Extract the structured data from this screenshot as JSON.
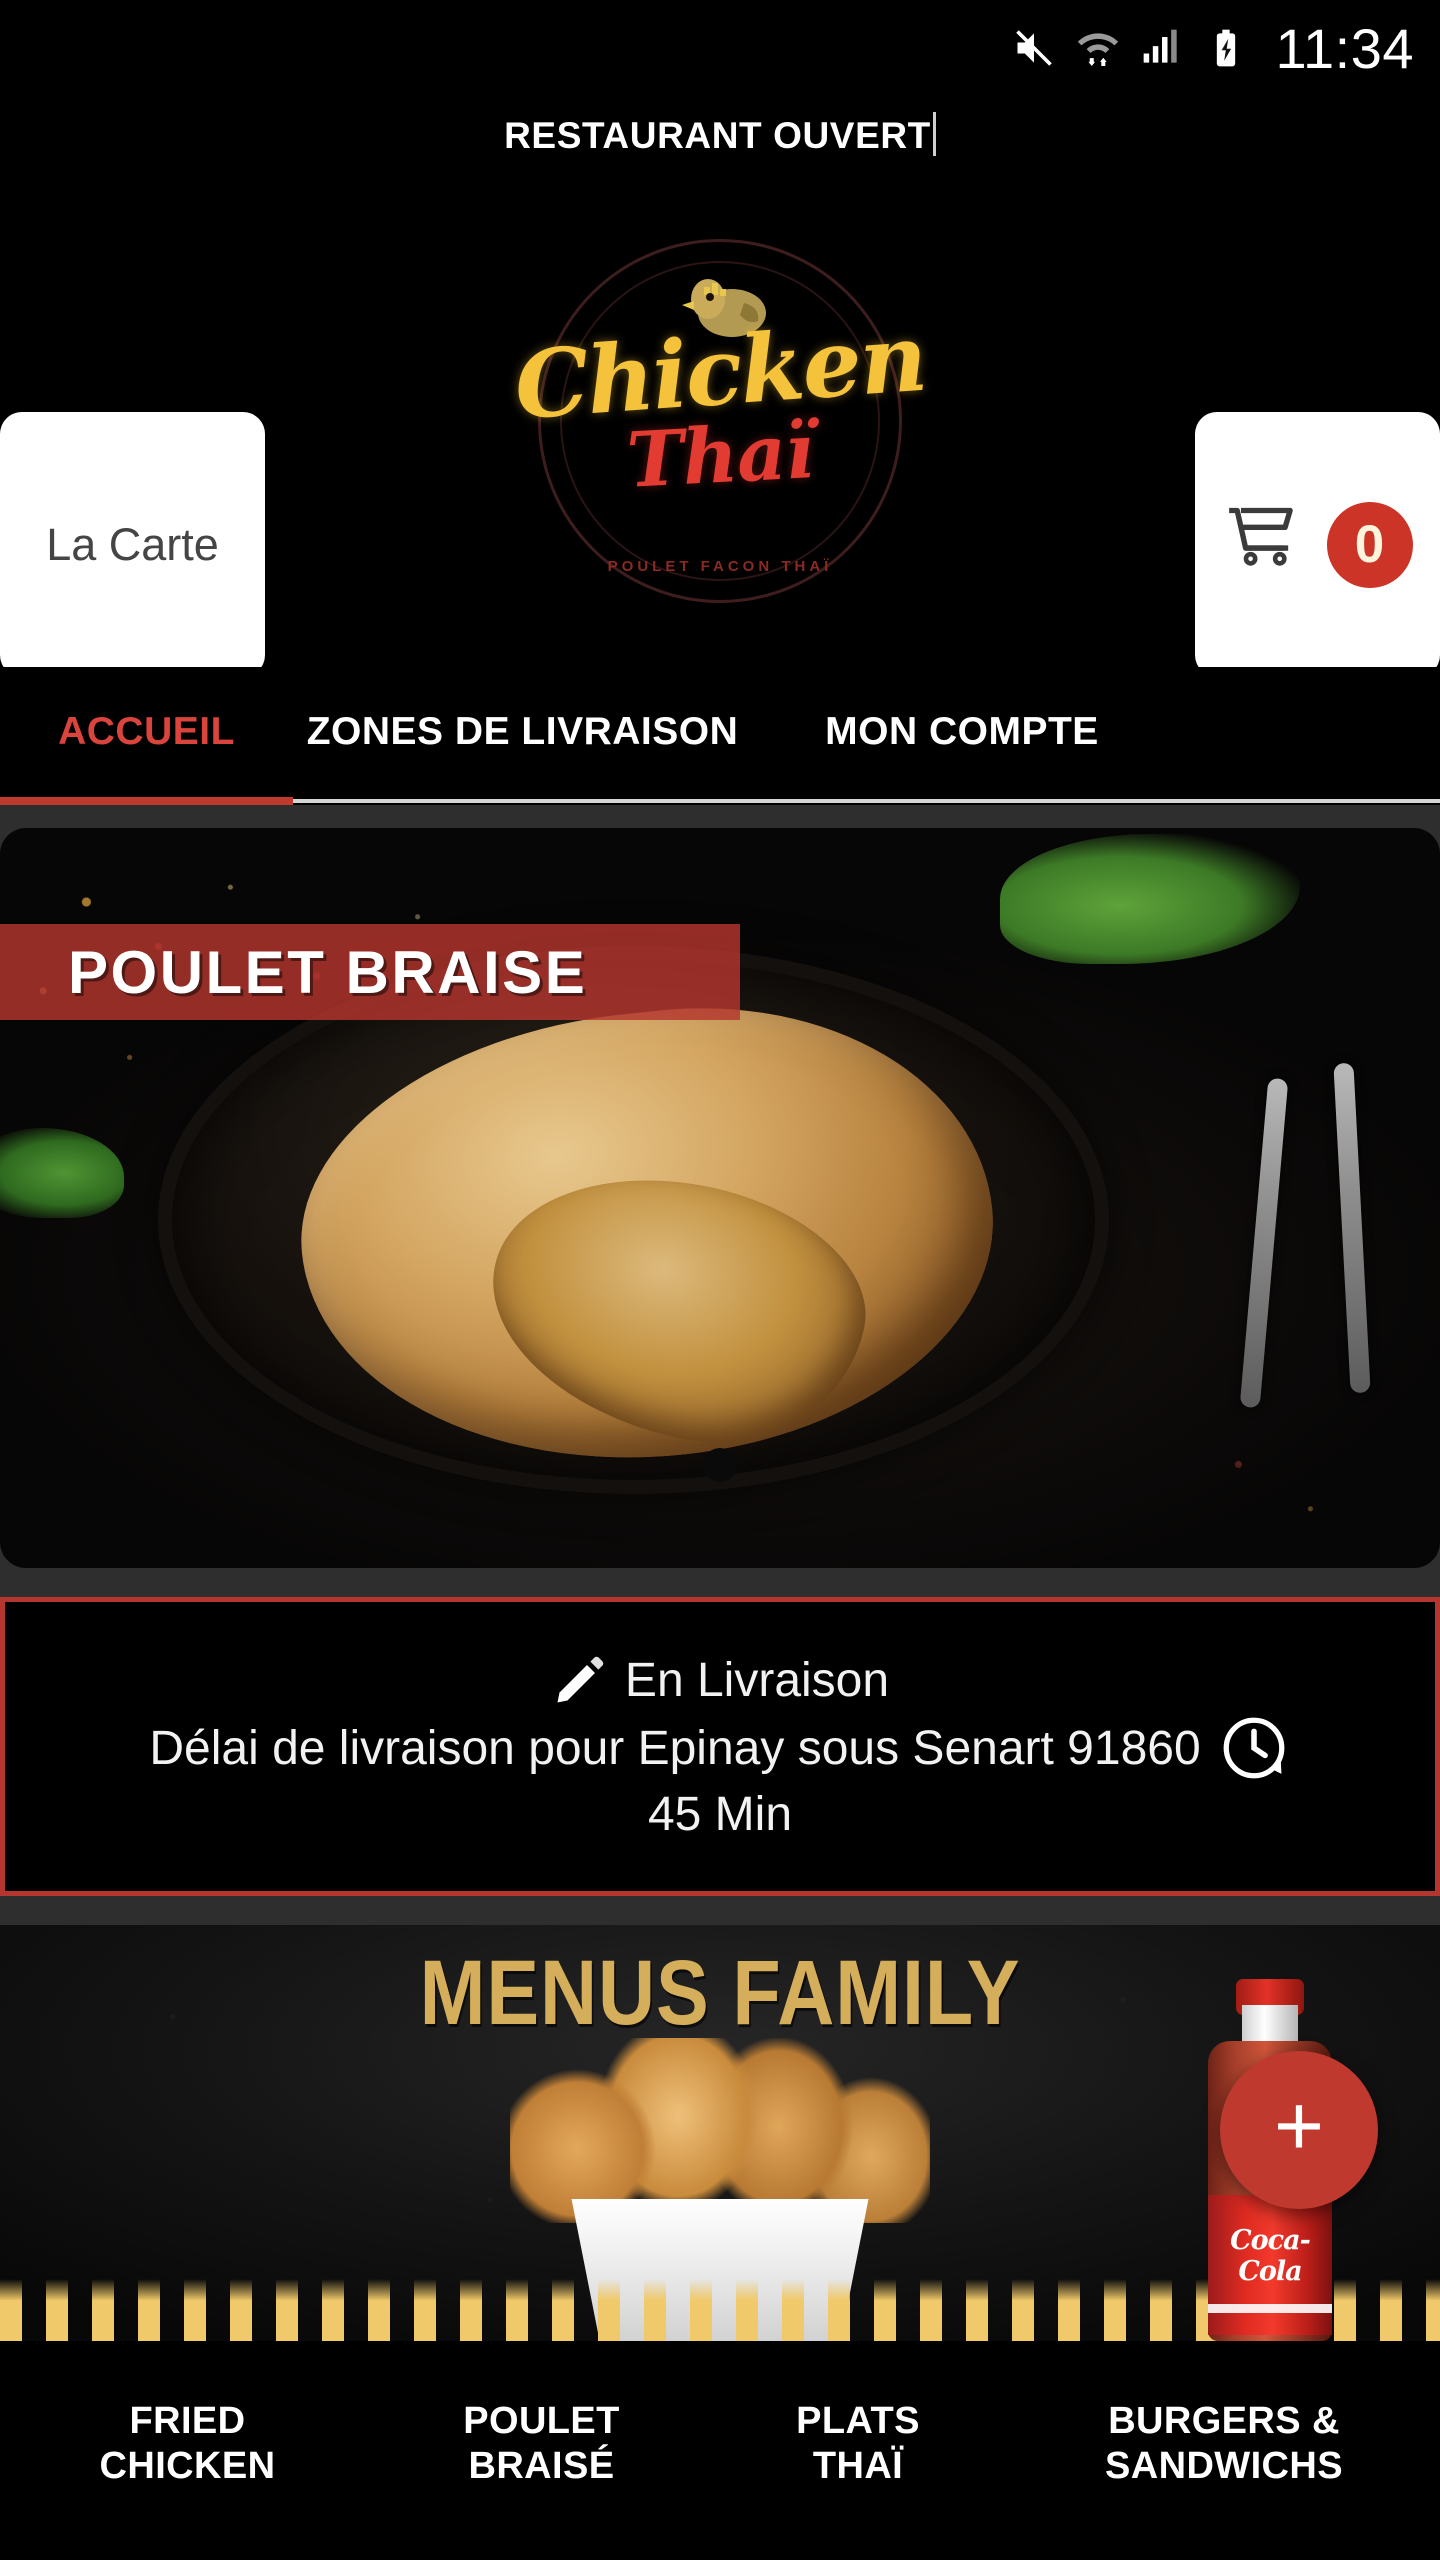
{
  "status_bar": {
    "time": "11:34",
    "icons": [
      "mute-icon",
      "wifi-icon",
      "signal-icon",
      "battery-charging-icon"
    ]
  },
  "open_banner": {
    "text": "RESTAURANT OUVERT"
  },
  "header": {
    "logo": {
      "word1": "Chicken",
      "word2": "Thaï",
      "tagline": "POULET FACON THAÏ"
    },
    "carte_button": {
      "label": "La Carte"
    },
    "cart_button": {
      "count": "0"
    }
  },
  "tabs": [
    {
      "label": "ACCUEIL",
      "active": true
    },
    {
      "label": "ZONES DE LIVRAISON",
      "active": false
    },
    {
      "label": "MON COMPTE",
      "active": false
    }
  ],
  "hero": {
    "banner_text": "POULET BRAISE"
  },
  "delivery": {
    "status": "En Livraison",
    "zone": "Délai de livraison pour Epinay sous Senart 91860",
    "time": "45 Min"
  },
  "promo": {
    "title": "MENUS FAMILY",
    "cola_label": "Coca-Cola",
    "add_button": "+"
  },
  "categories": [
    {
      "line1": "FRIED",
      "line2": "CHICKEN"
    },
    {
      "line1": "POULET",
      "line2": "BRAISÉ"
    },
    {
      "line1": "PLATS",
      "line2": "THAÏ"
    },
    {
      "line1": "BURGERS &",
      "line2": "SANDWICHS"
    }
  ],
  "colors": {
    "accent_red": "#c0392f",
    "brand_gold": "#f5c23c",
    "brand_red": "#e23b32",
    "promo_gold": "#d4ae5a",
    "surface_black": "#000000",
    "scroll_gray": "#2e2e2e"
  }
}
